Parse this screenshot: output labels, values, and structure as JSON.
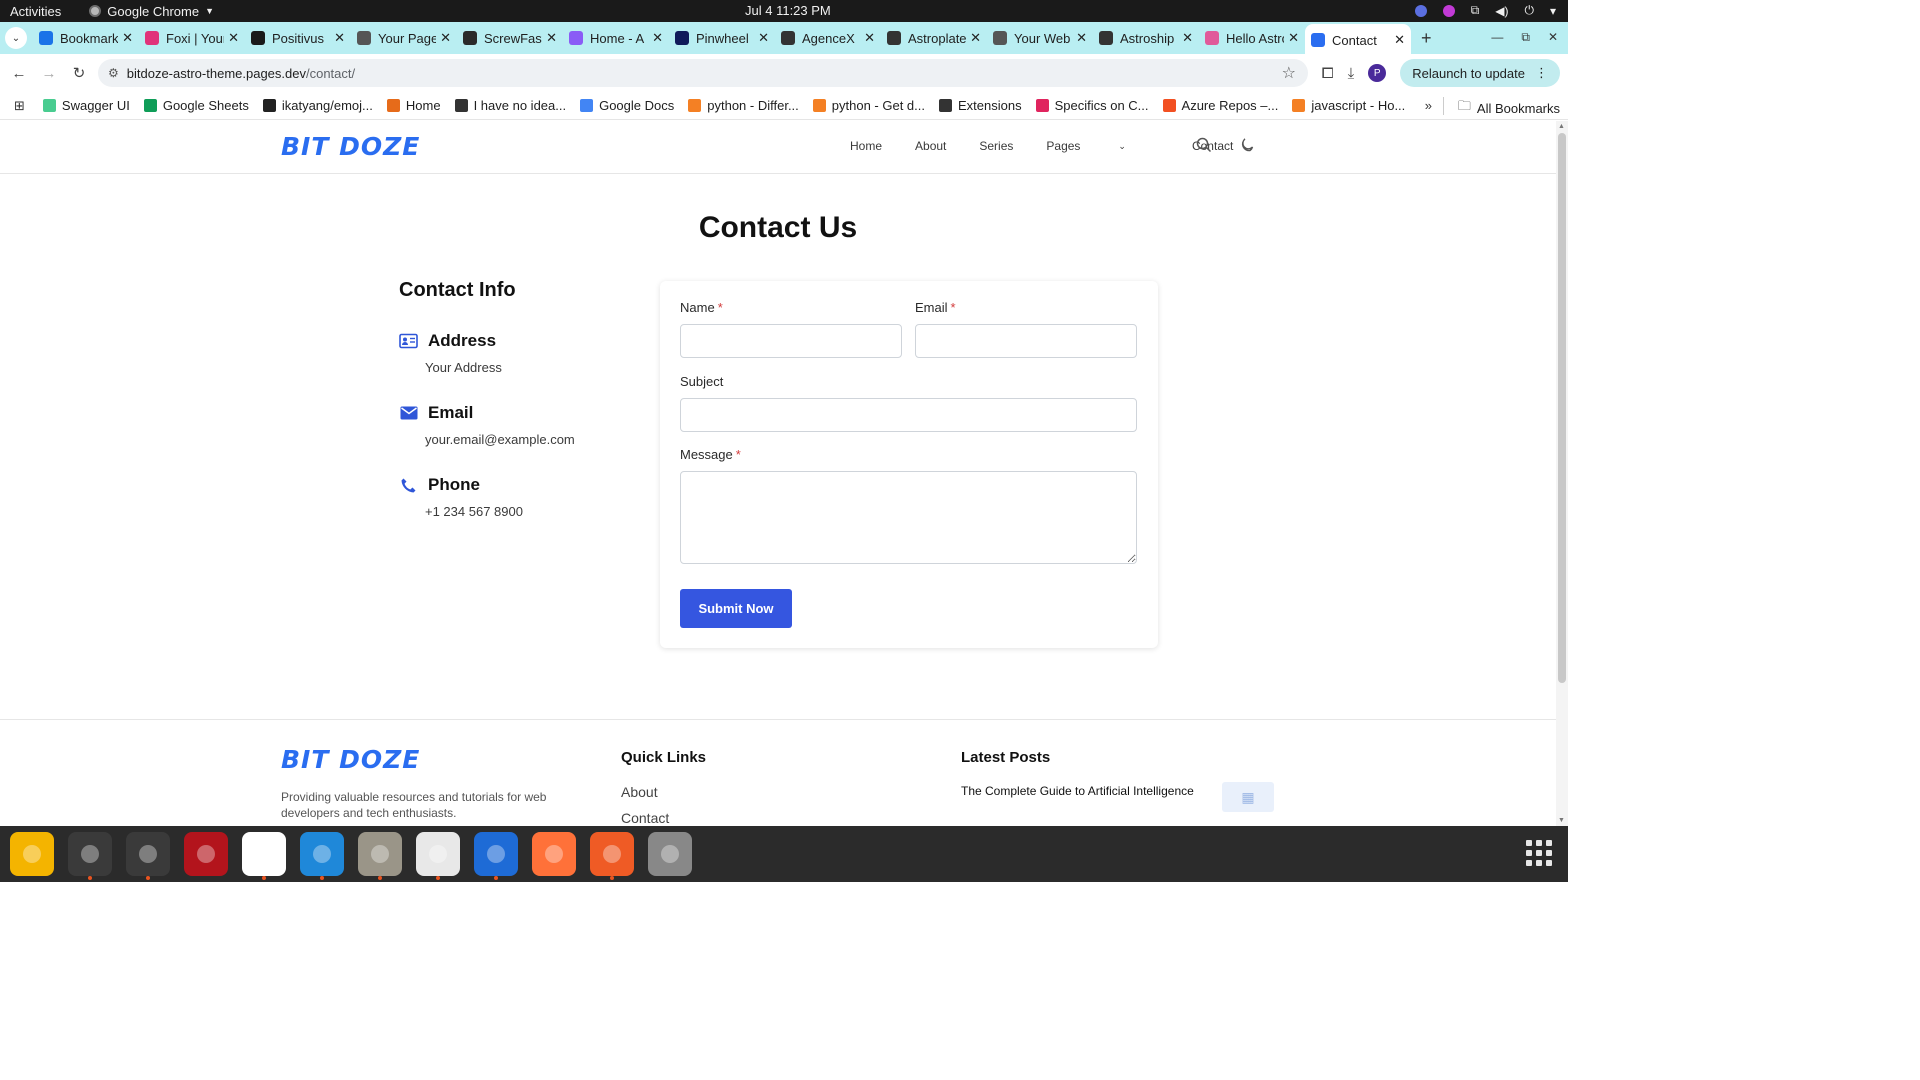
{
  "system": {
    "activities": "Activities",
    "app_name": "Google Chrome",
    "clock": "Jul 4  11:23 PM"
  },
  "browser": {
    "tabs": [
      {
        "title": "Bookmarks",
        "icon": "star-icon",
        "color": "#1a73e8"
      },
      {
        "title": "Foxi | Your",
        "icon": "fox-icon",
        "color": "#e0337a"
      },
      {
        "title": "Positivus",
        "icon": "positivus-icon",
        "color": "#1a1a1a"
      },
      {
        "title": "Your Page",
        "icon": "globe-icon",
        "color": "#555555"
      },
      {
        "title": "ScrewFast",
        "icon": "screwfast-icon",
        "color": "#2a2a2a"
      },
      {
        "title": "Home - A",
        "icon": "astro-icon",
        "color": "#8a5cf6"
      },
      {
        "title": "Pinwheel",
        "icon": "pinwheel-icon",
        "color": "#101a5a"
      },
      {
        "title": "AgenceX",
        "icon": "astro-icon",
        "color": "#333333"
      },
      {
        "title": "Astroplate",
        "icon": "astro-icon",
        "color": "#333333"
      },
      {
        "title": "Your Web",
        "icon": "globe-icon",
        "color": "#555555"
      },
      {
        "title": "Astroship",
        "icon": "astro-icon",
        "color": "#333333"
      },
      {
        "title": "Hello Astro",
        "icon": "astro-pink-icon",
        "color": "#e05a9a"
      },
      {
        "title": "Contact",
        "icon": "bitdoze-icon",
        "color": "#2a6df0",
        "active": true
      }
    ],
    "url_host": "bitdoze-astro-theme.pages.dev",
    "url_path": "/contact/",
    "relaunch_label": "Relaunch to update",
    "profile_initial": "P",
    "bookmarks": [
      {
        "label": "Swagger UI",
        "icon": "swagger-icon",
        "color": "#49cc90"
      },
      {
        "label": "Google Sheets",
        "icon": "sheets-icon",
        "color": "#0f9d58"
      },
      {
        "label": "ikatyang/emoj...",
        "icon": "github-icon",
        "color": "#222222"
      },
      {
        "label": "Home",
        "icon": "home-icon",
        "color": "#e66b1a"
      },
      {
        "label": "I have no idea...",
        "icon": "globe-icon",
        "color": "#333333"
      },
      {
        "label": "Google Docs",
        "icon": "docs-icon",
        "color": "#4285f4"
      },
      {
        "label": "python - Differ...",
        "icon": "stackoverflow-icon",
        "color": "#f48024"
      },
      {
        "label": "python - Get d...",
        "icon": "stackoverflow-icon",
        "color": "#f48024"
      },
      {
        "label": "Extensions",
        "icon": "puzzle-icon",
        "color": "#333333"
      },
      {
        "label": "Specifics on C...",
        "icon": "asterisk-icon",
        "color": "#e0245e"
      },
      {
        "label": "Azure Repos –...",
        "icon": "microsoft-icon",
        "color": "#f25022"
      },
      {
        "label": "javascript - Ho...",
        "icon": "stackoverflow-icon",
        "color": "#f48024"
      }
    ],
    "all_bookmarks_label": "All Bookmarks"
  },
  "site": {
    "logo": "BIT DOZE",
    "nav": {
      "home": "Home",
      "about": "About",
      "series": "Series",
      "pages": "Pages",
      "contact": "Contact"
    },
    "title": "Contact Us",
    "contact_info": {
      "heading": "Contact Info",
      "address_label": "Address",
      "address_value": "Your Address",
      "email_label": "Email",
      "email_value": "your.email@example.com",
      "phone_label": "Phone",
      "phone_value": "+1 234 567 8900"
    },
    "form": {
      "name_label": "Name",
      "email_label": "Email",
      "subject_label": "Subject",
      "message_label": "Message",
      "required_mark": "*",
      "name_value": "",
      "email_value": "",
      "subject_value": "",
      "message_value": "",
      "submit_label": "Submit Now"
    },
    "footer": {
      "description": "Providing valuable resources and tutorials for web developers and tech enthusiasts.",
      "quick_links_heading": "Quick Links",
      "quick_links": [
        "About",
        "Contact"
      ],
      "latest_posts_heading": "Latest Posts",
      "latest_post_title": "The Complete Guide to Artificial Intelligence"
    }
  },
  "colors": {
    "accent": "#3556e0",
    "logo": "#2a6df0",
    "tabstrip": "#b9eef2",
    "required": "#d23a3a"
  },
  "dock": [
    {
      "name": "notes",
      "icon": "notes-icon",
      "color": "#f4b400"
    },
    {
      "name": "system-monitor",
      "icon": "monitor-icon",
      "color": "#3a3a3a"
    },
    {
      "name": "terminal",
      "icon": "terminal-icon",
      "color": "#3a3a3a"
    },
    {
      "name": "filezilla",
      "icon": "filezilla-icon",
      "color": "#b3141c"
    },
    {
      "name": "chrome",
      "icon": "chrome-icon",
      "color": "#ffffff"
    },
    {
      "name": "vscode",
      "icon": "vscode-icon",
      "color": "#1f88d9"
    },
    {
      "name": "files",
      "icon": "folder-icon",
      "color": "#9a9588"
    },
    {
      "name": "text-editor",
      "icon": "editor-icon",
      "color": "#e8e8e8"
    },
    {
      "name": "thunderbird",
      "icon": "thunderbird-icon",
      "color": "#1e6bd6"
    },
    {
      "name": "firefox",
      "icon": "firefox-icon",
      "color": "#ff7139"
    },
    {
      "name": "postman",
      "icon": "postman-icon",
      "color": "#ef5b25"
    },
    {
      "name": "disk-utility",
      "icon": "disk-icon",
      "color": "#888888"
    }
  ]
}
